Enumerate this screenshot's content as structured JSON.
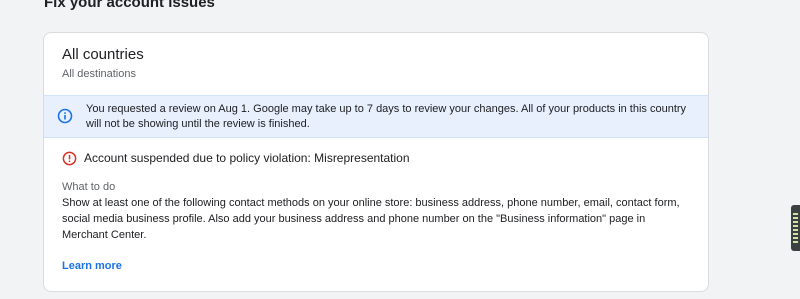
{
  "section": {
    "title": "Fix your account issues"
  },
  "card": {
    "title": "All countries",
    "subtitle": "All destinations",
    "info_banner": {
      "icon": "info-icon",
      "text": "You requested a review on Aug 1. Google may take up to 7 days to review your changes. All of your products in this country will not be showing until the review is finished."
    },
    "issue": {
      "icon": "error-icon",
      "text": "Account suspended due to policy violation: Misrepresentation"
    },
    "what_to_do": {
      "heading": "What to do",
      "text": "Show at least one of the following contact methods on your online store: business address, phone number, email, contact form, social media business profile. Also add your business address and phone number on the \"Business information\" page in Merchant Center."
    },
    "learn_more": "Learn more"
  },
  "colors": {
    "accent": "#1a73e8",
    "error": "#d93025",
    "banner_bg": "#e8f0fe"
  }
}
